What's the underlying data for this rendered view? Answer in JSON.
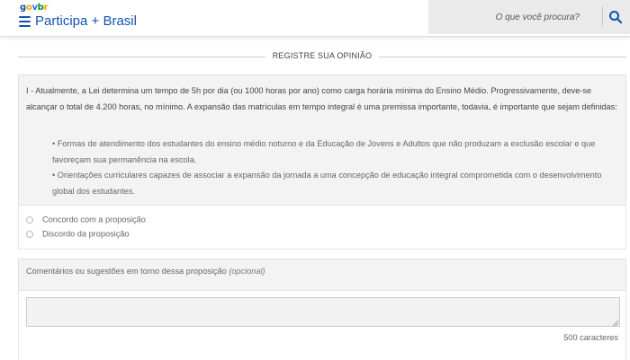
{
  "header": {
    "logo": {
      "g": "g",
      "o": "o",
      "v": "v",
      "b": "b",
      "r": "r"
    },
    "site_title": "Participa + Brasil",
    "search_placeholder": "O que você procura?"
  },
  "section_title": "REGISTRE SUA OPINIÃO",
  "proposal": {
    "text": "I - Atualmente, a Lei determina um tempo de 5h por dia (ou 1000 horas por ano) como carga horária mínima do Ensino Médio. Progressivamente, deve-se alcançar o total de 4.200 horas, no mínimo. A expansão das matrículas em tempo integral é uma premissa importante, todavia, é importante que sejam definidas:",
    "items": [
      "• Formas de atendimento dos estudantes do ensino médio noturno e da Educação de Jovens e Adultos que não produzam a exclusão escolar e que favoreçam sua permanência na escola.",
      "• Orientações curriculares capazes de associar a expansão da jornada a uma concepção de educação integral comprometida com o desenvolvimento global dos estudantes."
    ]
  },
  "options": [
    {
      "label": "Concordo com a proposição",
      "selected": false
    },
    {
      "label": "Discordo da proposição",
      "selected": false
    }
  ],
  "comments": {
    "label": "Comentários ou sugestões em torno dessa proposição",
    "optional": "(opcional)",
    "value": "",
    "char_count": "500 caracteres"
  },
  "colors": {
    "brand_blue": "#1351b4",
    "logo_yellow": "#f5a400",
    "logo_green": "#168821"
  }
}
